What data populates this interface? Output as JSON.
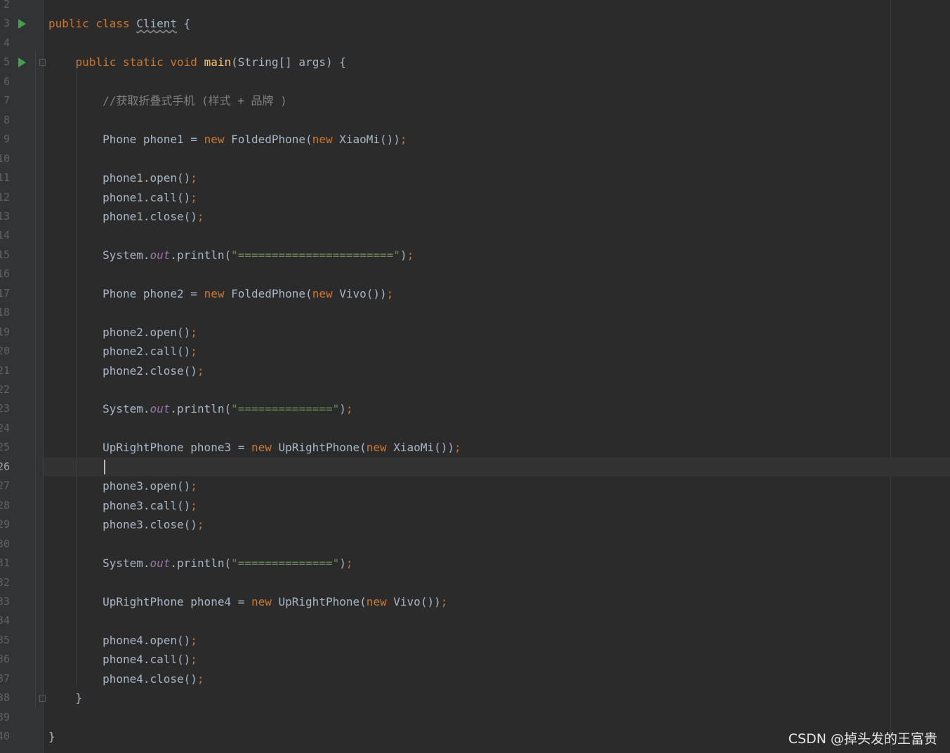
{
  "editor": {
    "lines": [
      {
        "num": "2",
        "tokens": []
      },
      {
        "num": "3",
        "run": true,
        "tokens": [
          [
            "kw",
            "public class "
          ],
          [
            "wavy",
            "Client"
          ],
          [
            "pl",
            " {"
          ]
        ]
      },
      {
        "num": "4",
        "tokens": []
      },
      {
        "num": "5",
        "run": true,
        "fold": true,
        "tokens": [
          [
            "pl",
            "    "
          ],
          [
            "kw",
            "public static void "
          ],
          [
            "fn",
            "main"
          ],
          [
            "pl",
            "(String[] args) {"
          ]
        ]
      },
      {
        "num": "6",
        "tokens": []
      },
      {
        "num": "7",
        "tokens": [
          [
            "pl",
            "        "
          ],
          [
            "cm",
            "//获取折叠式手机 (样式 + 品牌 )"
          ]
        ]
      },
      {
        "num": "8",
        "tokens": []
      },
      {
        "num": "9",
        "tokens": [
          [
            "pl",
            "        Phone phone1 = "
          ],
          [
            "kw",
            "new "
          ],
          [
            "pl",
            "FoldedPhone("
          ],
          [
            "kw",
            "new "
          ],
          [
            "pl",
            "XiaoMi())"
          ],
          [
            "kw",
            ";"
          ]
        ]
      },
      {
        "num": "10",
        "tokens": []
      },
      {
        "num": "11",
        "tokens": [
          [
            "pl",
            "        phone1.open()"
          ],
          [
            "kw",
            ";"
          ]
        ]
      },
      {
        "num": "12",
        "tokens": [
          [
            "pl",
            "        phone1.call()"
          ],
          [
            "kw",
            ";"
          ]
        ]
      },
      {
        "num": "13",
        "tokens": [
          [
            "pl",
            "        phone1.close()"
          ],
          [
            "kw",
            ";"
          ]
        ]
      },
      {
        "num": "14",
        "tokens": []
      },
      {
        "num": "15",
        "tokens": [
          [
            "pl",
            "        System."
          ],
          [
            "fld",
            "out"
          ],
          [
            "pl",
            ".println("
          ],
          [
            "st",
            "\"=======================\""
          ],
          [
            "pl",
            ")"
          ],
          [
            "kw",
            ";"
          ]
        ]
      },
      {
        "num": "16",
        "tokens": []
      },
      {
        "num": "17",
        "tokens": [
          [
            "pl",
            "        Phone phone2 = "
          ],
          [
            "kw",
            "new "
          ],
          [
            "pl",
            "FoldedPhone("
          ],
          [
            "kw",
            "new "
          ],
          [
            "pl",
            "Vivo())"
          ],
          [
            "kw",
            ";"
          ]
        ]
      },
      {
        "num": "18",
        "tokens": []
      },
      {
        "num": "19",
        "tokens": [
          [
            "pl",
            "        phone2.open()"
          ],
          [
            "kw",
            ";"
          ]
        ]
      },
      {
        "num": "20",
        "tokens": [
          [
            "pl",
            "        phone2.call()"
          ],
          [
            "kw",
            ";"
          ]
        ]
      },
      {
        "num": "21",
        "tokens": [
          [
            "pl",
            "        phone2.close()"
          ],
          [
            "kw",
            ";"
          ]
        ]
      },
      {
        "num": "22",
        "tokens": []
      },
      {
        "num": "23",
        "tokens": [
          [
            "pl",
            "        System."
          ],
          [
            "fld",
            "out"
          ],
          [
            "pl",
            ".println("
          ],
          [
            "st",
            "\"==============\""
          ],
          [
            "pl",
            ")"
          ],
          [
            "kw",
            ";"
          ]
        ]
      },
      {
        "num": "24",
        "tokens": []
      },
      {
        "num": "25",
        "tokens": [
          [
            "pl",
            "        UpRightPhone phone3 = "
          ],
          [
            "kw",
            "new "
          ],
          [
            "pl",
            "UpRightPhone("
          ],
          [
            "kw",
            "new "
          ],
          [
            "pl",
            "XiaoMi())"
          ],
          [
            "kw",
            ";"
          ]
        ]
      },
      {
        "num": "26",
        "current": true,
        "tokens": []
      },
      {
        "num": "27",
        "tokens": [
          [
            "pl",
            "        phone3.open()"
          ],
          [
            "kw",
            ";"
          ]
        ]
      },
      {
        "num": "28",
        "tokens": [
          [
            "pl",
            "        phone3.call()"
          ],
          [
            "kw",
            ";"
          ]
        ]
      },
      {
        "num": "29",
        "tokens": [
          [
            "pl",
            "        phone3.close()"
          ],
          [
            "kw",
            ";"
          ]
        ]
      },
      {
        "num": "30",
        "tokens": []
      },
      {
        "num": "31",
        "tokens": [
          [
            "pl",
            "        System."
          ],
          [
            "fld",
            "out"
          ],
          [
            "pl",
            ".println("
          ],
          [
            "st",
            "\"==============\""
          ],
          [
            "pl",
            ")"
          ],
          [
            "kw",
            ";"
          ]
        ]
      },
      {
        "num": "32",
        "tokens": []
      },
      {
        "num": "33",
        "tokens": [
          [
            "pl",
            "        UpRightPhone phone4 = "
          ],
          [
            "kw",
            "new "
          ],
          [
            "pl",
            "UpRightPhone("
          ],
          [
            "kw",
            "new "
          ],
          [
            "pl",
            "Vivo())"
          ],
          [
            "kw",
            ";"
          ]
        ]
      },
      {
        "num": "34",
        "tokens": []
      },
      {
        "num": "35",
        "tokens": [
          [
            "pl",
            "        phone4.open()"
          ],
          [
            "kw",
            ";"
          ]
        ]
      },
      {
        "num": "36",
        "tokens": [
          [
            "pl",
            "        phone4.call()"
          ],
          [
            "kw",
            ";"
          ]
        ]
      },
      {
        "num": "37",
        "tokens": [
          [
            "pl",
            "        phone4.close()"
          ],
          [
            "kw",
            ";"
          ]
        ]
      },
      {
        "num": "38",
        "fold": true,
        "tokens": [
          [
            "pl",
            "    }"
          ]
        ]
      },
      {
        "num": "39",
        "tokens": []
      },
      {
        "num": "40",
        "tokens": [
          [
            "pl",
            "}"
          ]
        ]
      }
    ]
  },
  "watermark": "CSDN @掉头发的王富贵",
  "colors": {
    "background": "#2b2b2b",
    "gutter": "#313335",
    "keyword": "#cc7832",
    "method": "#ffc66d",
    "string": "#6a8759",
    "comment": "#808080",
    "field": "#9876aa",
    "plain": "#a9b7c6",
    "run_icon": "#499c54"
  }
}
